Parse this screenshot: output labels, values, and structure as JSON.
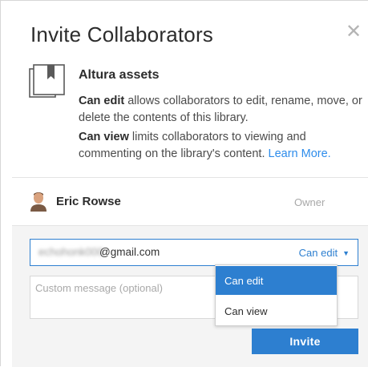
{
  "dialog": {
    "title": "Invite Collaborators",
    "close_glyph": "✕",
    "close_icon": "close-icon"
  },
  "library": {
    "icon": "library-icon",
    "name": "Altura assets",
    "can_edit_term": "Can edit",
    "can_edit_text": " allows collaborators to edit, rename, move, or delete the contents of this library.",
    "can_view_term": "Can view",
    "can_view_text": " limits collaborators to viewing and commenting on the library's content. ",
    "learn_more": "Learn More."
  },
  "owner": {
    "avatar": "user-avatar",
    "name": "Eric Rowse",
    "role": "Owner"
  },
  "invite_form": {
    "email_local_blurred": "echohonk000",
    "email_domain": "@gmail.com",
    "permission_selected": "Can edit",
    "message_placeholder": "Custom message (optional)",
    "invite_label": "Invite"
  },
  "permission_menu": {
    "options": [
      "Can edit",
      "Can view"
    ],
    "selected_index": 0
  },
  "colors": {
    "accent": "#2d7fd0",
    "link": "#2d8ceb",
    "muted": "#a8a8a8",
    "panel_bg": "#f4f4f4"
  }
}
